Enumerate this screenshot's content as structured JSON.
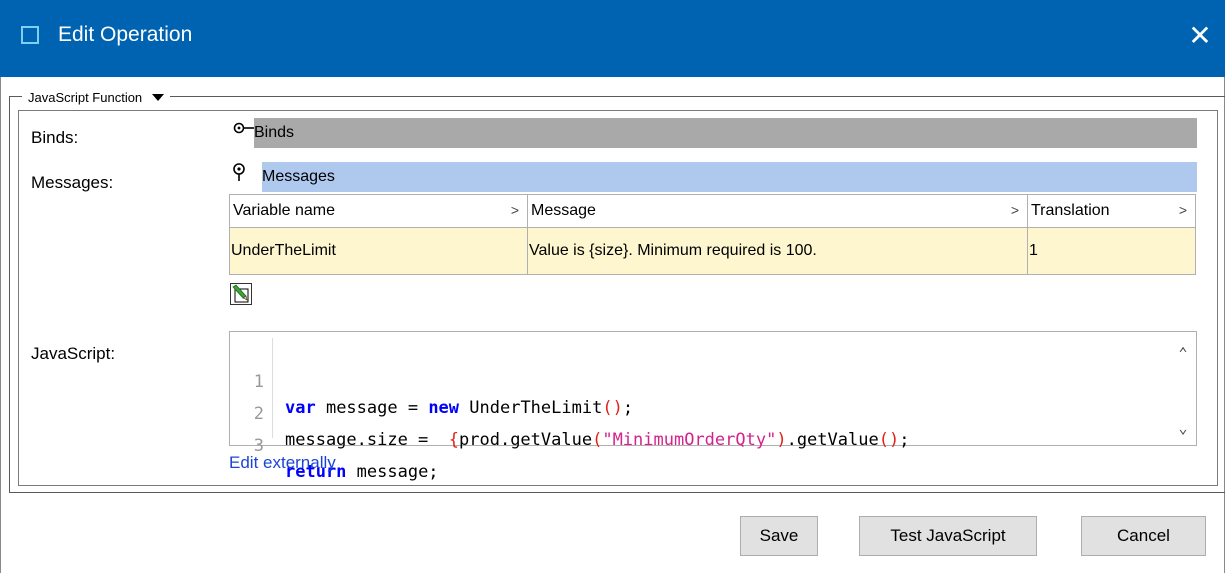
{
  "window": {
    "title": "Edit Operation",
    "close_icon": "close-icon",
    "accent_color": "#0063b1"
  },
  "group": {
    "legend": "JavaScript Function"
  },
  "binds": {
    "label": "Binds:",
    "bar_text": "Binds",
    "icon": "key-icon"
  },
  "messages": {
    "label": "Messages:",
    "bar_text": "Messages",
    "icon": "pin-icon",
    "columns": [
      "Variable name",
      "Message",
      "Translation"
    ],
    "rows": [
      {
        "variable": "UnderTheLimit",
        "message": "Value is {size}. Minimum required is 100.",
        "translation": "1"
      }
    ],
    "row_color": "#fdf6cf",
    "edit_icon": "pencil-edit-icon"
  },
  "javascript": {
    "label": "JavaScript:",
    "line_numbers": [
      "1",
      "2",
      "3"
    ],
    "edit_link": "Edit externally"
  },
  "buttons": {
    "save": "Save",
    "test": "Test JavaScript",
    "cancel": "Cancel"
  }
}
